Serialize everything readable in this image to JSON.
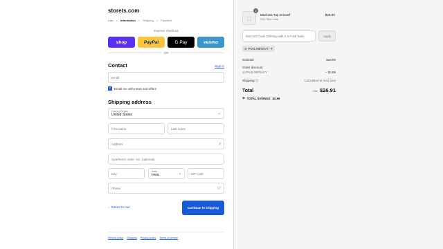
{
  "store": {
    "name": "storets.com"
  },
  "breadcrumb": {
    "cart": "Cart",
    "information": "Information",
    "shipping": "Shipping",
    "payment": "Payment",
    "separator": ">"
  },
  "express": {
    "label": "Express checkout",
    "buttons": {
      "shop": "shop",
      "paypal": "PayPal",
      "gpay": "G Pay",
      "venmo": "venmo"
    },
    "or": "OR"
  },
  "contact": {
    "title": "Contact",
    "sign_in": "Sign in",
    "email_placeholder": "Email",
    "newsletter_label": "Email me with news and offers",
    "newsletter_checked": true
  },
  "shipping_address": {
    "title": "Shipping address",
    "country_label": "Country/Region",
    "country_value": "United States",
    "first_name": "First name",
    "last_name": "Last name",
    "address": "Address",
    "apartment": "Apartment, suite, etc. (optional)",
    "city": "City",
    "state_label": "State",
    "state_value": "Iowa",
    "zip": "ZIP code",
    "phone": "Phone"
  },
  "actions": {
    "return": "Return to cart",
    "continue": "Continue to shipping"
  },
  "footer": {
    "links": [
      "Refund policy",
      "Shipping",
      "Privacy policy",
      "Terms of service"
    ]
  },
  "order": {
    "quantity": "1",
    "product_name": "Marlowe Top w/Scarf",
    "product_variant": "S/M / Blue Gray",
    "product_price": "$29.90",
    "discount_placeholder": "Discount Code (Starting with X is Final Sale)",
    "apply": "Apply",
    "applied_code": "PAULINENAVY",
    "subtotal_label": "Subtotal",
    "subtotal_value": "$29.90",
    "order_discount_label": "Order discount",
    "discount_code": "PAULINENAVY",
    "discount_value": "– $2.99",
    "shipping_label": "Shipping",
    "shipping_value": "Calculated at next step",
    "total_label": "Total",
    "currency": "USD",
    "total_value": "$26.91",
    "savings_label": "TOTAL SAVINGS",
    "savings_value": "$2.99"
  },
  "colors": {
    "accent": "#1a5ad7",
    "shop": "#5a31f4",
    "paypal": "#ffc439",
    "venmo": "#3d95ce"
  }
}
